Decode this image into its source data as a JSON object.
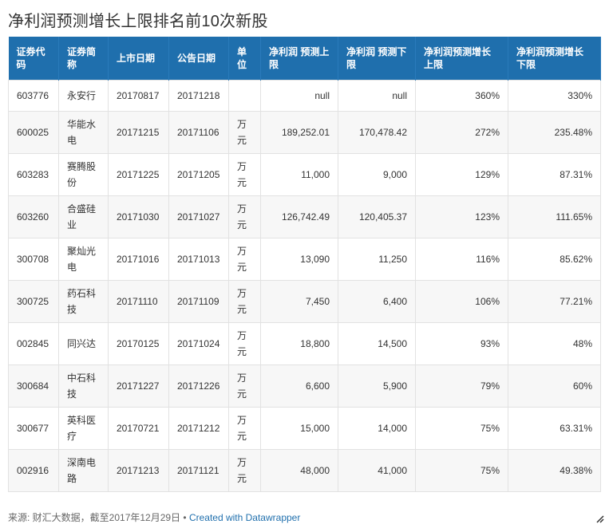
{
  "chart_data": {
    "type": "table",
    "title": "净利润预测增长上限排名前10次新股",
    "columns": [
      "证券代码",
      "证券简称",
      "上市日期",
      "公告日期",
      "单位",
      "净利润 预测上限",
      "净利润 预测下限",
      "净利润预测增长上限",
      "净利润预测增长下限"
    ],
    "rows": [
      [
        "603776",
        "永安行",
        "20170817",
        "20171218",
        "",
        "null",
        "null",
        "360%",
        "330%"
      ],
      [
        "600025",
        "华能水电",
        "20171215",
        "20171106",
        "万元",
        "189,252.01",
        "170,478.42",
        "272%",
        "235.48%"
      ],
      [
        "603283",
        "赛腾股份",
        "20171225",
        "20171205",
        "万元",
        "11,000",
        "9,000",
        "129%",
        "87.31%"
      ],
      [
        "603260",
        "合盛硅业",
        "20171030",
        "20171027",
        "万元",
        "126,742.49",
        "120,405.37",
        "123%",
        "111.65%"
      ],
      [
        "300708",
        "聚灿光电",
        "20171016",
        "20171013",
        "万元",
        "13,090",
        "11,250",
        "116%",
        "85.62%"
      ],
      [
        "300725",
        "药石科技",
        "20171110",
        "20171109",
        "万元",
        "7,450",
        "6,400",
        "106%",
        "77.21%"
      ],
      [
        "002845",
        "同兴达",
        "20170125",
        "20171024",
        "万元",
        "18,800",
        "14,500",
        "93%",
        "48%"
      ],
      [
        "300684",
        "中石科技",
        "20171227",
        "20171226",
        "万元",
        "6,600",
        "5,900",
        "79%",
        "60%"
      ],
      [
        "300677",
        "英科医疗",
        "20170721",
        "20171212",
        "万元",
        "15,000",
        "14,000",
        "75%",
        "63.31%"
      ],
      [
        "002916",
        "深南电路",
        "20171213",
        "20171121",
        "万元",
        "48,000",
        "41,000",
        "75%",
        "49.38%"
      ]
    ]
  },
  "footer": {
    "source": "来源: 财汇大数据，截至2017年12月29日",
    "separator": " • ",
    "credit": "Created with Datawrapper"
  },
  "colors": {
    "header_bg": "#1f6fad",
    "header_text": "#ffffff",
    "link": "#1f6fad"
  },
  "icons": {
    "resize": "resize-icon"
  }
}
